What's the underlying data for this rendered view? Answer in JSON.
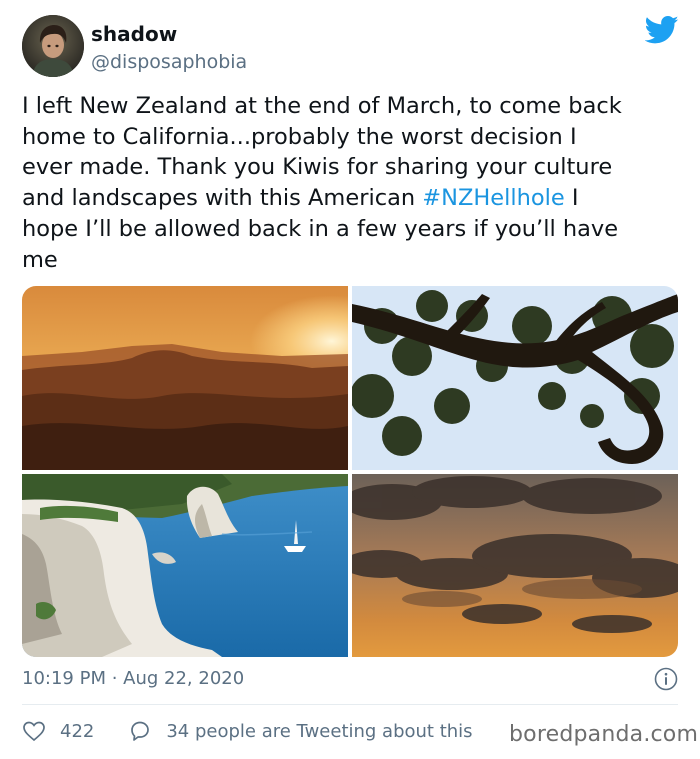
{
  "user": {
    "display_name": "shadow",
    "handle": "@disposaphobia",
    "avatar_icon": "profile-photo",
    "platform_icon": "twitter-bird-icon",
    "accent": "#1da1f2"
  },
  "tweet": {
    "lines": [
      "I left New Zealand at the end of March, to come back",
      "home to California...probably the worst decision I",
      "ever made. Thank you Kiwis for sharing your culture",
      "hope I’ll be allowed back in a few years if you’ll have",
      "me"
    ],
    "line4_before": "and landscapes with this American ",
    "hashtag": "#NZHellhole",
    "line4_after": " I",
    "hashtag_color": "#1b95e0"
  },
  "media": [
    {
      "icon": "sunset-hills-photo"
    },
    {
      "icon": "tree-branch-photo"
    },
    {
      "icon": "coastal-cliffs-photo"
    },
    {
      "icon": "cloudy-sunset-photo"
    }
  ],
  "meta": {
    "time": "10:19 PM",
    "separator": " · ",
    "date": "Aug 22, 2020",
    "info_icon": "info-icon"
  },
  "actions": {
    "like_count": "422",
    "like_icon": "heart-icon",
    "conversation_text": "34 people are Tweeting about this",
    "conversation_icon": "speech-bubble-icon"
  },
  "watermark": "boredpanda.com"
}
